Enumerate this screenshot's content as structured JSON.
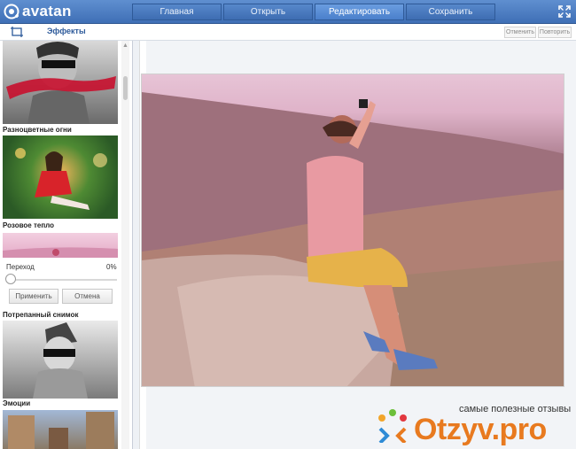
{
  "app": {
    "logo_text": "avatan"
  },
  "nav": {
    "tabs": [
      "Главная",
      "Открыть",
      "Редактировать",
      "Сохранить"
    ],
    "active": "Редактировать"
  },
  "toolbar": {
    "effects_label": "Эффекты",
    "undo_label": "Отменить",
    "redo_label": "Повторить"
  },
  "sidebar": {
    "effects": [
      {
        "label": "Разноцветные огни"
      },
      {
        "label": "Розовое тепло"
      },
      {
        "label": "Потрепанный снимок"
      },
      {
        "label": "Эмоции"
      }
    ],
    "slider": {
      "label": "Переход",
      "value": "0%",
      "level": 0
    },
    "apply_label": "Применить",
    "cancel_label": "Отмена"
  },
  "watermark": {
    "tagline": "самые полезные отзывы",
    "brand": "Otzyv.pro"
  },
  "colors": {
    "header": "#4a7bc2",
    "accent": "#2d5a9a",
    "brand_orange": "#e87a1f"
  }
}
